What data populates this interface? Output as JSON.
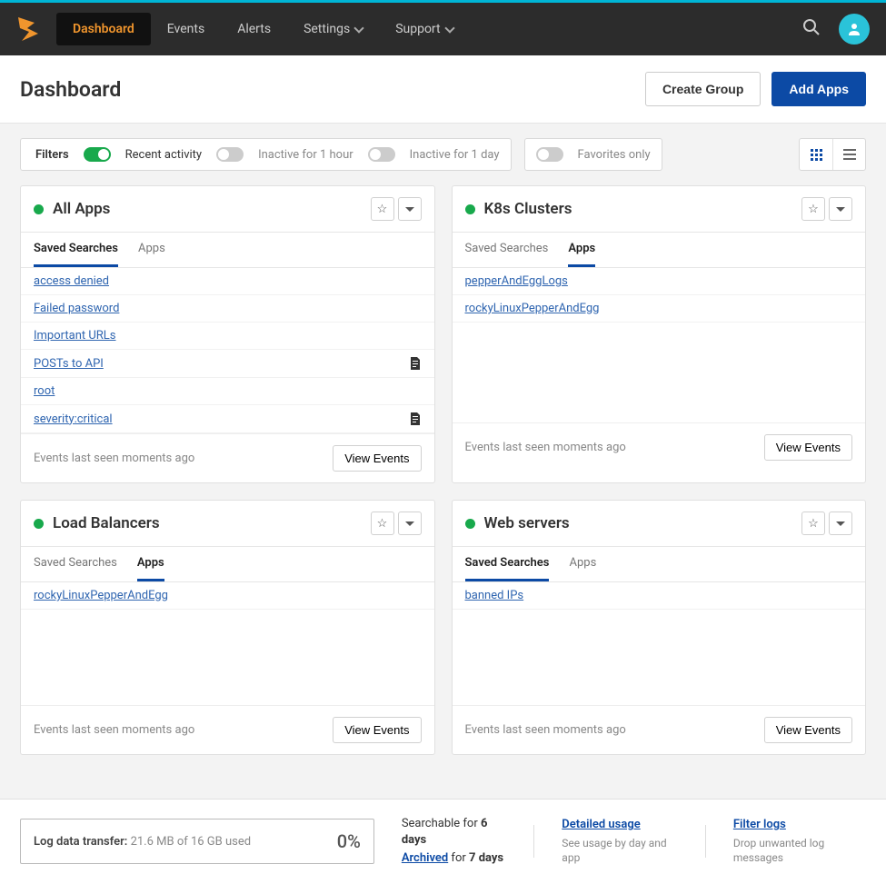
{
  "nav": {
    "items": [
      {
        "label": "Dashboard"
      },
      {
        "label": "Events"
      },
      {
        "label": "Alerts"
      },
      {
        "label": "Settings"
      },
      {
        "label": "Support"
      }
    ]
  },
  "page": {
    "title": "Dashboard",
    "create_group": "Create Group",
    "add_apps": "Add Apps"
  },
  "filters": {
    "label": "Filters",
    "recent": "Recent activity",
    "inactive_1h": "Inactive for 1 hour",
    "inactive_1d": "Inactive for 1 day",
    "favorites": "Favorites only"
  },
  "tab_labels": {
    "saved": "Saved Searches",
    "apps": "Apps"
  },
  "view_events": "View Events",
  "cards": [
    {
      "title": "All Apps",
      "active_tab": "saved",
      "items": [
        {
          "label": "access denied"
        },
        {
          "label": "Failed password"
        },
        {
          "label": "Important URLs"
        },
        {
          "label": "POSTs to API",
          "doc": true
        },
        {
          "label": "root"
        },
        {
          "label": "severity:critical",
          "doc": true
        }
      ],
      "footer": "Events last seen moments ago"
    },
    {
      "title": "K8s Clusters",
      "active_tab": "apps",
      "items": [
        {
          "label": "pepperAndEggLogs"
        },
        {
          "label": "rockyLinuxPepperAndEgg"
        }
      ],
      "footer": "Events last seen moments ago"
    },
    {
      "title": "Load Balancers",
      "active_tab": "apps",
      "items": [
        {
          "label": "rockyLinuxPepperAndEgg"
        }
      ],
      "footer": "Events last seen moments ago"
    },
    {
      "title": "Web servers",
      "active_tab": "saved",
      "items": [
        {
          "label": "banned IPs"
        }
      ],
      "footer": "Events last seen moments ago"
    }
  ],
  "bottom": {
    "log_label": "Log data transfer:",
    "log_detail": " 21.6 MB of 16 GB used",
    "pct": "0%",
    "searchable_pre": "Searchable for ",
    "searchable_bold": "6 days",
    "archived_link": "Archived",
    "archived_for": " for ",
    "archived_bold": "7 days",
    "detailed_usage": "Detailed usage",
    "detailed_sub": "See usage by day and app",
    "filter_logs": "Filter logs",
    "filter_sub": "Drop unwanted log messages"
  }
}
